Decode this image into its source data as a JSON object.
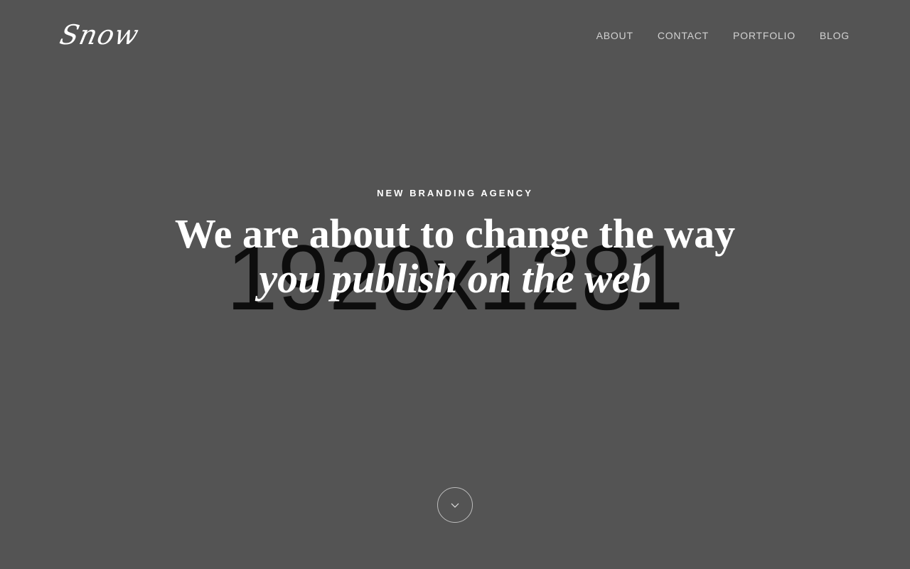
{
  "header": {
    "logo_text": "Snow",
    "nav": [
      {
        "label": "ABOUT"
      },
      {
        "label": "CONTACT"
      },
      {
        "label": "PORTFOLIO"
      },
      {
        "label": "BLOG"
      }
    ]
  },
  "hero": {
    "placeholder_text": "1920x1281",
    "kicker": "NEW BRANDING AGENCY",
    "headline_line1": "We are about to change the way",
    "headline_line2": "you publish on the web",
    "scroll_icon": "chevron-down-icon"
  },
  "colors": {
    "background": "#545454",
    "text": "#ffffff",
    "nav_text": "#d2d2d2",
    "placeholder_text": "#0d0d0d"
  }
}
